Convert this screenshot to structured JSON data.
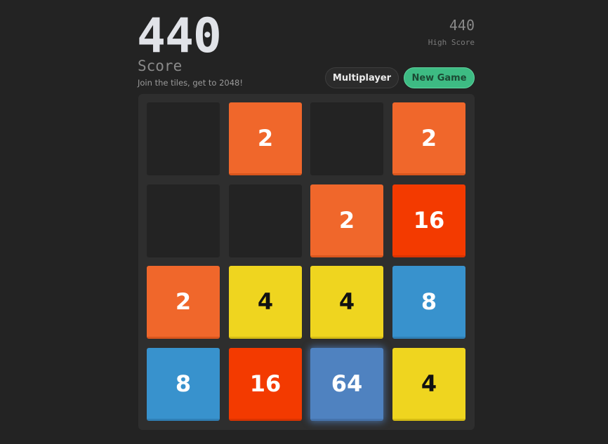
{
  "header": {
    "score": "440",
    "score_label": "Score",
    "subtitle": "Join the tiles, get to 2048!",
    "high_score": "440",
    "high_score_label": "High Score"
  },
  "buttons": {
    "multiplayer": "Multiplayer",
    "new_game": "New Game"
  },
  "colors": {
    "tile_2": "#f0672b",
    "tile_4": "#efd51f",
    "tile_8": "#3892cd",
    "tile_16": "#f33a00",
    "tile_64": "#4f82c0",
    "new_game_accent": "#3dbb83"
  },
  "board": {
    "rows": [
      [
        "",
        "2",
        "",
        "2"
      ],
      [
        "",
        "",
        "2",
        "16"
      ],
      [
        "2",
        "4",
        "4",
        "8"
      ],
      [
        "8",
        "16",
        "64",
        "4"
      ]
    ]
  }
}
